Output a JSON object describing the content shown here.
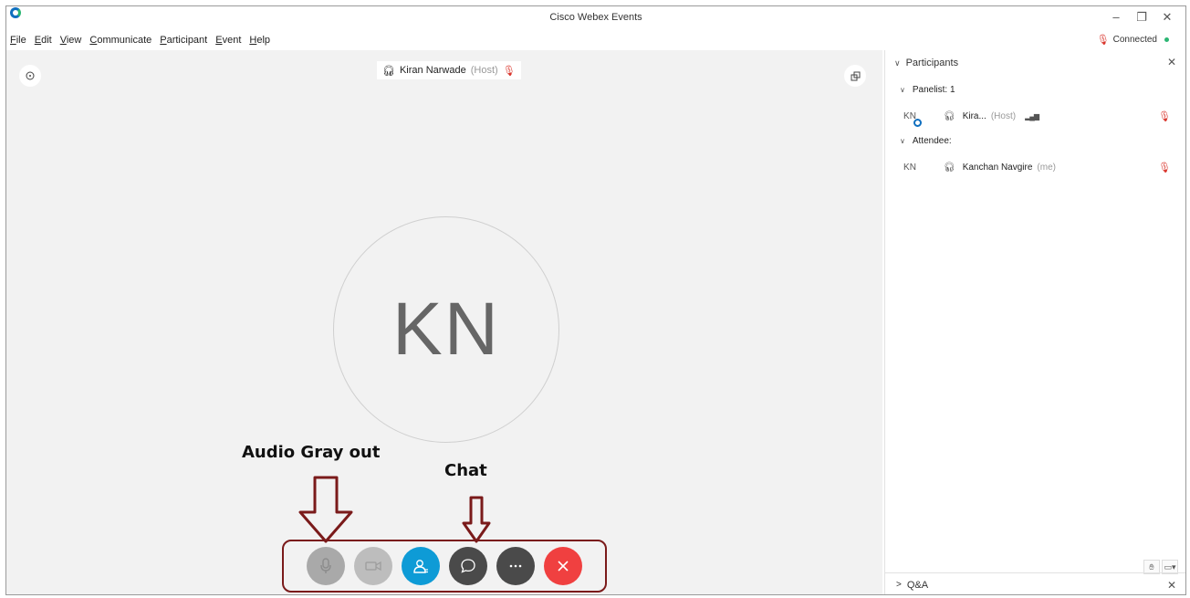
{
  "window": {
    "title": "Cisco Webex Events",
    "controls": {
      "minimize": "–",
      "restore": "❐",
      "close": "✕"
    }
  },
  "menu": [
    "File",
    "Edit",
    "View",
    "Communicate",
    "Participant",
    "Event",
    "Help"
  ],
  "status": {
    "text": "Connected",
    "dot_color": "#2bb673",
    "mic_color": "#d9342b"
  },
  "stage": {
    "speaker_name": "Kiran Narwade",
    "speaker_role": "(Host)",
    "avatar_initials": "KN"
  },
  "annotations": {
    "audio_label": "Audio Gray out",
    "chat_label": "Chat",
    "color": "#7a1a1a"
  },
  "controls": [
    {
      "name": "audio-button",
      "icon": "microphone-icon",
      "state": "disabled"
    },
    {
      "name": "video-button",
      "icon": "camera-icon",
      "state": "disabled"
    },
    {
      "name": "participants-button",
      "icon": "participants-icon",
      "state": "active"
    },
    {
      "name": "chat-button",
      "icon": "chat-bubble-icon",
      "state": "normal"
    },
    {
      "name": "more-button",
      "icon": "more-icon",
      "state": "normal"
    },
    {
      "name": "leave-button",
      "icon": "close-icon",
      "state": "danger"
    }
  ],
  "panel": {
    "title": "Participants",
    "panelists_label": "Panelist: 1",
    "attendees_label": "Attendee:",
    "panelists": [
      {
        "initials": "KN",
        "name": "Kira...",
        "role": "(Host)"
      }
    ],
    "attendees": [
      {
        "initials": "KN",
        "name": "Kanchan Navgire",
        "role": "(me)"
      }
    ],
    "qa_label": "Q&A"
  }
}
